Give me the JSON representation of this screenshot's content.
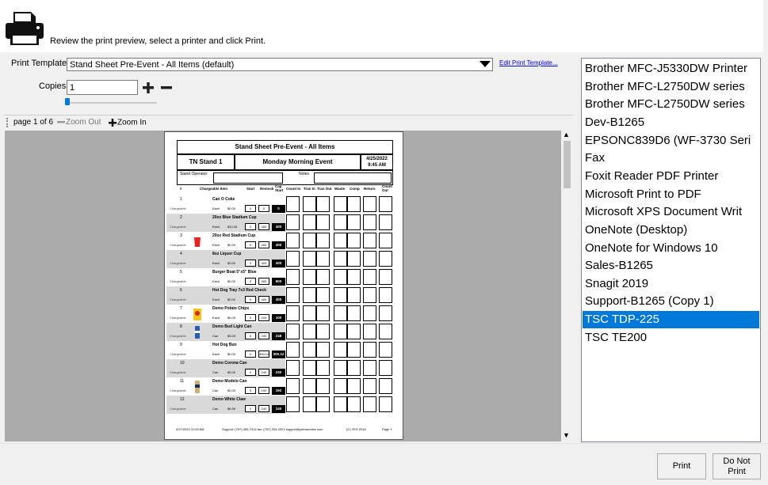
{
  "header": {
    "instruction": "Review the print preview, select a printer and click Print."
  },
  "template": {
    "label": "Print Template",
    "value": "Stand Sheet Pre-Event - All Items (default)",
    "edit_link": "Edit Print Template..."
  },
  "copies": {
    "label": "Copies",
    "value": "1"
  },
  "toolbar": {
    "page_indicator": "page 1 of 6",
    "zoom_out": "Zoom Out",
    "zoom_in": "Zoom In"
  },
  "sheet": {
    "title": "Stand Sheet Pre-Event - All Items",
    "stand": "TN Stand 1",
    "event": "Monday Morning Event",
    "date": "4/25/2022",
    "time": "9:45 AM",
    "operator_label": "Stand Operator:",
    "notes_label": "Notes",
    "columns": [
      "#",
      "Chargeable Item",
      "Start",
      "Restock",
      "Cap Start",
      "Count In",
      "Tran In",
      "Tran Out",
      "Waste",
      "Comp",
      "Return",
      "Count Out"
    ],
    "items": [
      {
        "num": "1",
        "type": "Chargeable",
        "name": "Can O Coke",
        "unit": "Each",
        "price": "$0.00",
        "start": "0",
        "restock": "0",
        "cap": "0",
        "shaded": false
      },
      {
        "num": "2",
        "type": "Chargeable",
        "name": "20oz Blue Stadium Cup",
        "unit": "Each",
        "price": "$10.00",
        "start": "0",
        "restock": "400",
        "cap": "400",
        "shaded": true
      },
      {
        "num": "3",
        "type": "Chargeable",
        "name": "20oz Red Stadium Cup",
        "unit": "Each",
        "price": "$0.00",
        "start": "0",
        "restock": "400",
        "cap": "400",
        "shaded": false
      },
      {
        "num": "4",
        "type": "Chargeable",
        "name": "8oz Liquor Cup",
        "unit": "Each",
        "price": "$0.00",
        "start": "0",
        "restock": "400",
        "cap": "400",
        "shaded": true
      },
      {
        "num": "5",
        "type": "Chargeable",
        "name": "Burger Boat 5\"x5\" Blue",
        "unit": "Each",
        "price": "$0.00",
        "start": "0",
        "restock": "600",
        "cap": "600",
        "shaded": false
      },
      {
        "num": "6",
        "type": "Chargeable",
        "name": "Hot Dog Tray 7x3 Red Check",
        "unit": "Each",
        "price": "$0.00",
        "start": "0",
        "restock": "400",
        "cap": "400",
        "shaded": true
      },
      {
        "num": "7",
        "type": "Chargeable",
        "name": "Demo Potato Chips",
        "unit": "Each",
        "price": "$0.00",
        "start": "0",
        "restock": "100",
        "cap": "100",
        "shaded": false
      },
      {
        "num": "8",
        "type": "Chargeable",
        "name": "Demo Bud Light Can",
        "unit": "Can",
        "price": "$0.00",
        "start": "0",
        "restock": "240",
        "cap": "248",
        "shaded": true
      },
      {
        "num": "9",
        "type": "Chargeable",
        "name": "Hot Dog Bun",
        "unit": "Each",
        "price": "$0.00",
        "start": "0",
        "restock": "300.12",
        "cap": "300.12",
        "shaded": false
      },
      {
        "num": "10",
        "type": "Chargeable",
        "name": "Demo Corona Can",
        "unit": "Can",
        "price": "$0.00",
        "start": "0",
        "restock": "240",
        "cap": "240",
        "shaded": true
      },
      {
        "num": "11",
        "type": "Chargeable",
        "name": "Demo Modelo Can",
        "unit": "Can",
        "price": "$0.00",
        "start": "0",
        "restock": "192",
        "cap": "192",
        "shaded": false
      },
      {
        "num": "12",
        "type": "Chargeable",
        "name": "Demo White Claw",
        "unit": "Can",
        "price": "$6.99",
        "start": "0",
        "restock": "240",
        "cap": "240",
        "shaded": true
      }
    ],
    "footer_date": "4/27/2022 11:09 AM",
    "footer_support": "Support: (757) 463-7314 fax: (757) 204-2021 support@yetroundinc.com",
    "footer_copy": "(C) YES 2018",
    "footer_page": "Page 1"
  },
  "printers": {
    "items": [
      "Brother MFC-J5330DW Printer",
      "Brother MFC-L2750DW series",
      "Brother MFC-L2750DW series",
      "Dev-B1265",
      "EPSONC839D6  (WF-3730 Seri",
      "Fax",
      "Foxit Reader PDF Printer",
      "Microsoft Print to PDF",
      "Microsoft  XPS  Document Writ",
      "OneNote (Desktop)",
      "OneNote for Windows 10",
      "Sales-B1265",
      "Snagit 2019",
      "Support-B1265 (Copy 1)",
      "TSC TDP-225",
      "TSC TE200"
    ],
    "selected": "TSC TDP-225",
    "selected_color": "#0078d7"
  },
  "buttons": {
    "print": "Print",
    "do_not_print_1": "Do Not",
    "do_not_print_2": "Print"
  },
  "icons": [
    "printer-icon",
    "plus-icon",
    "minus-icon",
    "zoom-out-icon",
    "zoom-in-icon",
    "dropdown-arrow-icon"
  ]
}
